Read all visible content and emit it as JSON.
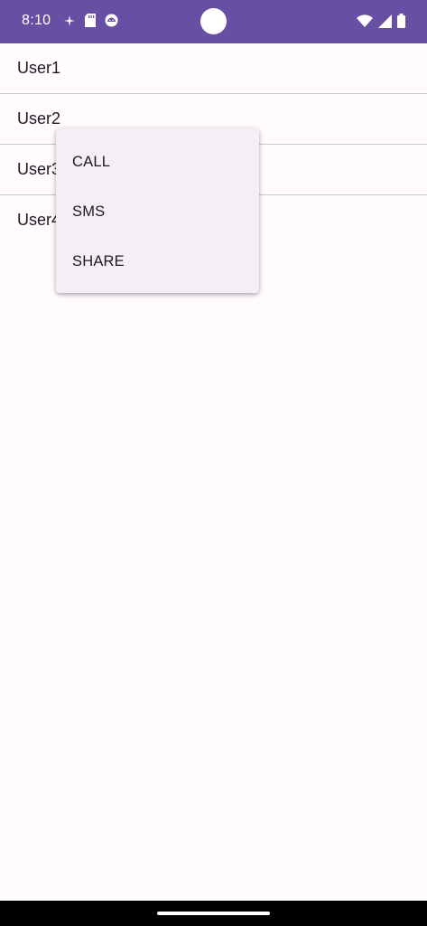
{
  "status_bar": {
    "time": "8:10",
    "left_icons": [
      "fan-icon",
      "sd-card-icon",
      "android-icon"
    ],
    "right_icons": [
      "wifi-icon",
      "signal-icon",
      "battery-icon"
    ],
    "color": "#6750a4"
  },
  "list": {
    "items": [
      {
        "label": "User1"
      },
      {
        "label": "User2"
      },
      {
        "label": "User3"
      },
      {
        "label": "User4"
      }
    ]
  },
  "context_menu": {
    "items": [
      {
        "label": "CALL"
      },
      {
        "label": "SMS"
      },
      {
        "label": "SHARE"
      }
    ]
  }
}
